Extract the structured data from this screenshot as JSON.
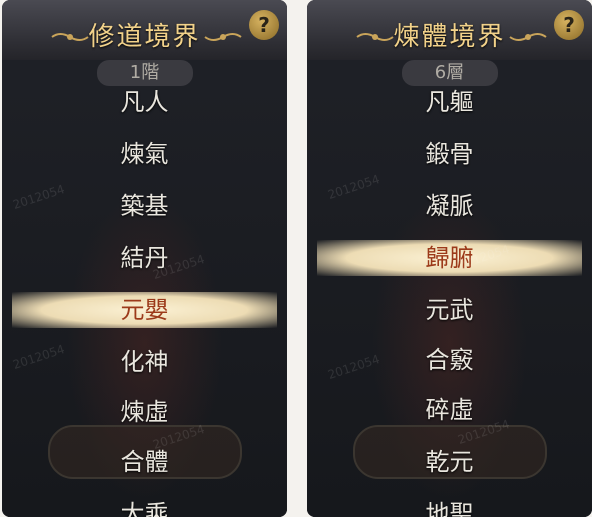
{
  "panels": [
    {
      "title": "修道境界",
      "floor_badge": "1階",
      "items": [
        "凡人",
        "煉氣",
        "築基",
        "結丹",
        "元嬰",
        "化神",
        "煉虛",
        "合體",
        "大乘"
      ],
      "selected_index": 4,
      "help_icon": "?"
    },
    {
      "title": "煉體境界",
      "floor_badge": "6層",
      "items": [
        "凡軀",
        "鍛骨",
        "凝脈",
        "歸腑",
        "元武",
        "合竅",
        "碎虛",
        "乾元",
        "地聖"
      ],
      "selected_index": 3,
      "help_icon": "?"
    }
  ],
  "watermark": "2012054",
  "colors": {
    "title": "#f2d28a",
    "item_text": "#e9e6de",
    "selected_text": "#9c3a1a",
    "selected_band": "#f3e6c2"
  }
}
